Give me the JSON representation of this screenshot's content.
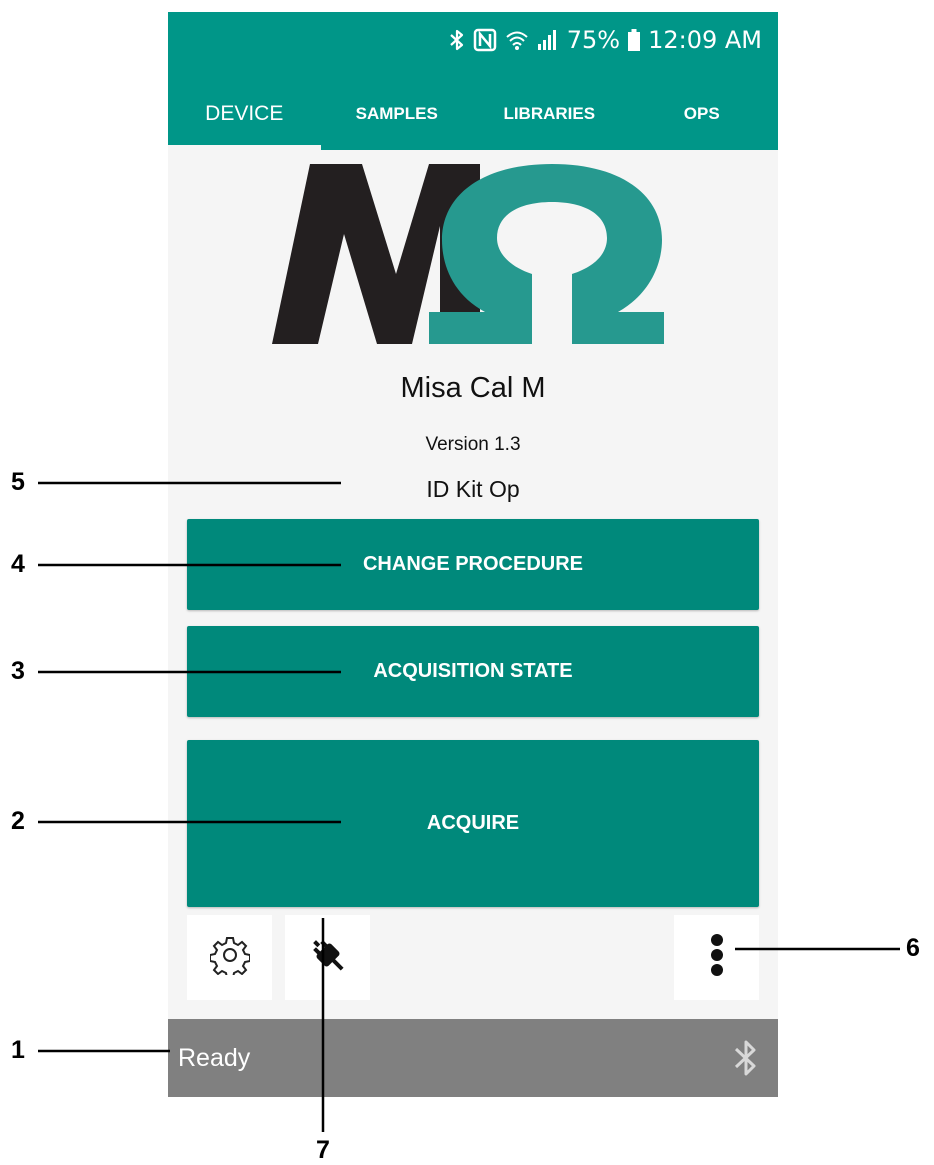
{
  "status_bar": {
    "battery": "75%",
    "time": "12:09 AM",
    "icons": [
      "bluetooth-icon",
      "nfc-icon",
      "wifi-icon",
      "signal-icon",
      "battery-icon"
    ]
  },
  "tabs": [
    {
      "label": "DEVICE",
      "active": true
    },
    {
      "label": "SAMPLES",
      "active": false
    },
    {
      "label": "LIBRARIES",
      "active": false
    },
    {
      "label": "OPS",
      "active": false
    }
  ],
  "logo": {
    "letter": "M",
    "symbol": "Ω",
    "colors": {
      "letter": "#231f20",
      "symbol": "#26998f"
    }
  },
  "device": {
    "name": "Misa Cal M",
    "version": "Version 1.3",
    "procedure": "ID Kit Op"
  },
  "buttons": {
    "change_procedure": "CHANGE PROCEDURE",
    "acquisition_state": "ACQUISITION STATE",
    "acquire": "ACQUIRE"
  },
  "toolbar": {
    "icons": [
      "settings-gear-icon",
      "connection-plug-icon",
      "more-vert-icon"
    ]
  },
  "footer": {
    "status": "Ready",
    "icon": "bluetooth-icon"
  },
  "callouts": [
    "1",
    "2",
    "3",
    "4",
    "5",
    "6",
    "7"
  ],
  "colors": {
    "accent": "#009688",
    "button": "#00897b",
    "footer": "#808080"
  }
}
